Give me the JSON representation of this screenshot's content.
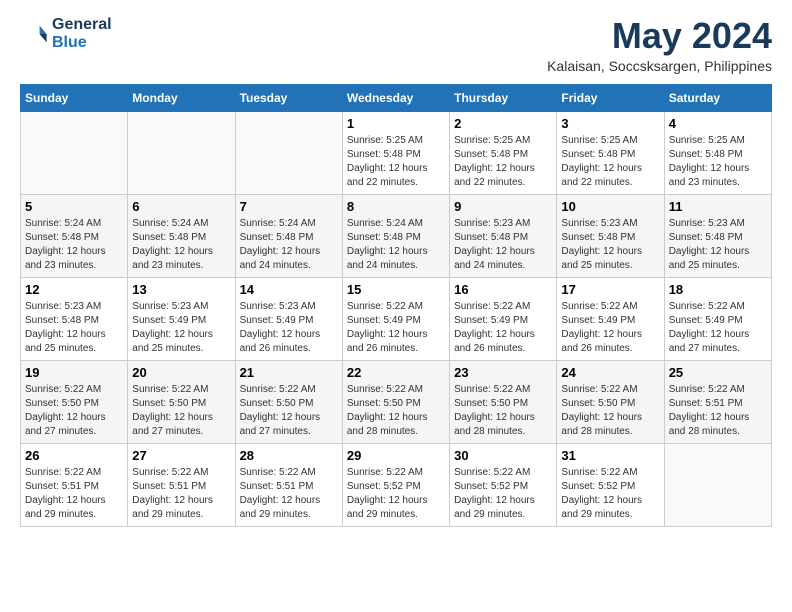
{
  "logo": {
    "line1": "General",
    "line2": "Blue"
  },
  "title": {
    "month_year": "May 2024",
    "location": "Kalaisan, Soccsksargen, Philippines"
  },
  "weekdays": [
    "Sunday",
    "Monday",
    "Tuesday",
    "Wednesday",
    "Thursday",
    "Friday",
    "Saturday"
  ],
  "weeks": [
    [
      {
        "day": "",
        "info": ""
      },
      {
        "day": "",
        "info": ""
      },
      {
        "day": "",
        "info": ""
      },
      {
        "day": "1",
        "info": "Sunrise: 5:25 AM\nSunset: 5:48 PM\nDaylight: 12 hours\nand 22 minutes."
      },
      {
        "day": "2",
        "info": "Sunrise: 5:25 AM\nSunset: 5:48 PM\nDaylight: 12 hours\nand 22 minutes."
      },
      {
        "day": "3",
        "info": "Sunrise: 5:25 AM\nSunset: 5:48 PM\nDaylight: 12 hours\nand 22 minutes."
      },
      {
        "day": "4",
        "info": "Sunrise: 5:25 AM\nSunset: 5:48 PM\nDaylight: 12 hours\nand 23 minutes."
      }
    ],
    [
      {
        "day": "5",
        "info": "Sunrise: 5:24 AM\nSunset: 5:48 PM\nDaylight: 12 hours\nand 23 minutes."
      },
      {
        "day": "6",
        "info": "Sunrise: 5:24 AM\nSunset: 5:48 PM\nDaylight: 12 hours\nand 23 minutes."
      },
      {
        "day": "7",
        "info": "Sunrise: 5:24 AM\nSunset: 5:48 PM\nDaylight: 12 hours\nand 24 minutes."
      },
      {
        "day": "8",
        "info": "Sunrise: 5:24 AM\nSunset: 5:48 PM\nDaylight: 12 hours\nand 24 minutes."
      },
      {
        "day": "9",
        "info": "Sunrise: 5:23 AM\nSunset: 5:48 PM\nDaylight: 12 hours\nand 24 minutes."
      },
      {
        "day": "10",
        "info": "Sunrise: 5:23 AM\nSunset: 5:48 PM\nDaylight: 12 hours\nand 25 minutes."
      },
      {
        "day": "11",
        "info": "Sunrise: 5:23 AM\nSunset: 5:48 PM\nDaylight: 12 hours\nand 25 minutes."
      }
    ],
    [
      {
        "day": "12",
        "info": "Sunrise: 5:23 AM\nSunset: 5:48 PM\nDaylight: 12 hours\nand 25 minutes."
      },
      {
        "day": "13",
        "info": "Sunrise: 5:23 AM\nSunset: 5:49 PM\nDaylight: 12 hours\nand 25 minutes."
      },
      {
        "day": "14",
        "info": "Sunrise: 5:23 AM\nSunset: 5:49 PM\nDaylight: 12 hours\nand 26 minutes."
      },
      {
        "day": "15",
        "info": "Sunrise: 5:22 AM\nSunset: 5:49 PM\nDaylight: 12 hours\nand 26 minutes."
      },
      {
        "day": "16",
        "info": "Sunrise: 5:22 AM\nSunset: 5:49 PM\nDaylight: 12 hours\nand 26 minutes."
      },
      {
        "day": "17",
        "info": "Sunrise: 5:22 AM\nSunset: 5:49 PM\nDaylight: 12 hours\nand 26 minutes."
      },
      {
        "day": "18",
        "info": "Sunrise: 5:22 AM\nSunset: 5:49 PM\nDaylight: 12 hours\nand 27 minutes."
      }
    ],
    [
      {
        "day": "19",
        "info": "Sunrise: 5:22 AM\nSunset: 5:50 PM\nDaylight: 12 hours\nand 27 minutes."
      },
      {
        "day": "20",
        "info": "Sunrise: 5:22 AM\nSunset: 5:50 PM\nDaylight: 12 hours\nand 27 minutes."
      },
      {
        "day": "21",
        "info": "Sunrise: 5:22 AM\nSunset: 5:50 PM\nDaylight: 12 hours\nand 27 minutes."
      },
      {
        "day": "22",
        "info": "Sunrise: 5:22 AM\nSunset: 5:50 PM\nDaylight: 12 hours\nand 28 minutes."
      },
      {
        "day": "23",
        "info": "Sunrise: 5:22 AM\nSunset: 5:50 PM\nDaylight: 12 hours\nand 28 minutes."
      },
      {
        "day": "24",
        "info": "Sunrise: 5:22 AM\nSunset: 5:50 PM\nDaylight: 12 hours\nand 28 minutes."
      },
      {
        "day": "25",
        "info": "Sunrise: 5:22 AM\nSunset: 5:51 PM\nDaylight: 12 hours\nand 28 minutes."
      }
    ],
    [
      {
        "day": "26",
        "info": "Sunrise: 5:22 AM\nSunset: 5:51 PM\nDaylight: 12 hours\nand 29 minutes."
      },
      {
        "day": "27",
        "info": "Sunrise: 5:22 AM\nSunset: 5:51 PM\nDaylight: 12 hours\nand 29 minutes."
      },
      {
        "day": "28",
        "info": "Sunrise: 5:22 AM\nSunset: 5:51 PM\nDaylight: 12 hours\nand 29 minutes."
      },
      {
        "day": "29",
        "info": "Sunrise: 5:22 AM\nSunset: 5:52 PM\nDaylight: 12 hours\nand 29 minutes."
      },
      {
        "day": "30",
        "info": "Sunrise: 5:22 AM\nSunset: 5:52 PM\nDaylight: 12 hours\nand 29 minutes."
      },
      {
        "day": "31",
        "info": "Sunrise: 5:22 AM\nSunset: 5:52 PM\nDaylight: 12 hours\nand 29 minutes."
      },
      {
        "day": "",
        "info": ""
      }
    ]
  ]
}
